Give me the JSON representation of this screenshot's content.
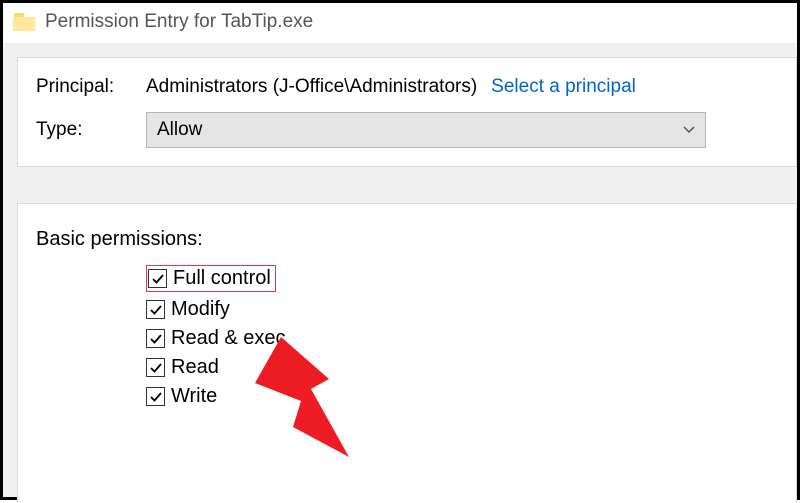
{
  "window": {
    "title": "Permission Entry for TabTip.exe"
  },
  "principal": {
    "label": "Principal:",
    "value": "Administrators (J-Office\\Administrators)",
    "select_link": "Select a principal"
  },
  "type": {
    "label": "Type:",
    "value": "Allow"
  },
  "permissions": {
    "title": "Basic permissions:",
    "items": [
      {
        "label": "Full control",
        "checked": true,
        "highlighted": true
      },
      {
        "label": "Modify",
        "checked": true,
        "highlighted": false
      },
      {
        "label": "Read & exec",
        "checked": true,
        "highlighted": false
      },
      {
        "label": "Read",
        "checked": true,
        "highlighted": false
      },
      {
        "label": "Write",
        "checked": true,
        "highlighted": false
      }
    ]
  }
}
